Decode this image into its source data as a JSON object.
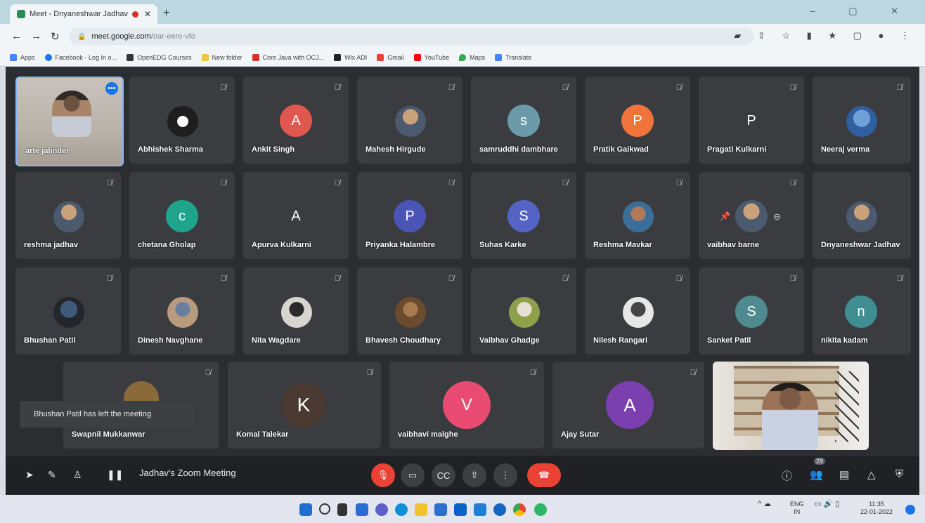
{
  "browser": {
    "tab_title": "Meet - Dnyaneshwar Jadhav",
    "new_tab": "+",
    "window_controls": "– ▢ ✕",
    "url_host": "meet.google.com",
    "url_path": "/oar-eere-vfo",
    "bookmarks": [
      {
        "label": "Apps",
        "color": "#4285f4"
      },
      {
        "label": "Facebook - Log In o...",
        "color": "#1877f2"
      },
      {
        "label": "OpenEDG Courses",
        "color": "#333333"
      },
      {
        "label": "New folder",
        "color": "#f4c542"
      },
      {
        "label": "Core Java with OCJ...",
        "color": "#d93025"
      },
      {
        "label": "Wix ADI",
        "color": "#222222"
      },
      {
        "label": "Gmail",
        "color": "#ea4335"
      },
      {
        "label": "YouTube",
        "color": "#ff0000"
      },
      {
        "label": "Maps",
        "color": "#34a853"
      },
      {
        "label": "Translate",
        "color": "#4285f4"
      }
    ]
  },
  "participants_row1": [
    {
      "name": "arte jalinder",
      "type": "self"
    },
    {
      "name": "Abhishek Sharma",
      "initial": "",
      "color": "#3a3c40",
      "photo": true
    },
    {
      "name": "Ankit Singh",
      "initial": "A",
      "color": "#e0574f"
    },
    {
      "name": "Mahesh Hirgude",
      "initial": "",
      "color": "#3a3c40",
      "photo": true
    },
    {
      "name": "samruddhi dambhare",
      "initial": "s",
      "color": "#6b9aa8"
    },
    {
      "name": "Pratik Gaikwad",
      "initial": "P",
      "color": "#f0733c"
    },
    {
      "name": "Pragati Kulkarni",
      "initial": "P",
      "color": "#3a3c40"
    },
    {
      "name": "Neeraj verma",
      "initial": "",
      "color": "#3a3c40",
      "photo": true
    }
  ],
  "participants_row2": [
    {
      "name": "reshma jadhav",
      "initial": "",
      "photo": true
    },
    {
      "name": "chetana Gholap",
      "initial": "c",
      "color": "#1fa58c"
    },
    {
      "name": "Apurva Kulkarni",
      "initial": "A",
      "color": "#3a3c40"
    },
    {
      "name": "Priyanka Halambre",
      "initial": "P",
      "color": "#4b55b5"
    },
    {
      "name": "Suhas Karke",
      "initial": "S",
      "color": "#5563c4"
    },
    {
      "name": "Reshma Mavkar",
      "initial": "",
      "photo": true
    },
    {
      "name": "vaibhav barne",
      "initial": "",
      "photo": true
    },
    {
      "name": "Dnyaneshwar Jadhav",
      "initial": "",
      "photo": true
    }
  ],
  "participants_row3": [
    {
      "name": "Bhushan Patil",
      "initial": "",
      "photo": true
    },
    {
      "name": "Dinesh Navghane",
      "initial": "",
      "photo": true
    },
    {
      "name": "Nita Wagdare",
      "initial": "",
      "photo": true
    },
    {
      "name": "Bhavesh Choudhary",
      "initial": "",
      "photo": true
    },
    {
      "name": "Vaibhav Ghadge",
      "initial": "",
      "photo": true
    },
    {
      "name": "Nilesh Rangari",
      "initial": "",
      "photo": true
    },
    {
      "name": "Sanket Patil",
      "initial": "S",
      "color": "#4f8a8f"
    },
    {
      "name": "nikita kadam",
      "initial": "n",
      "color": "#3e8e92"
    }
  ],
  "participants_row4": [
    {
      "name": "Swapnil Mukkanwar",
      "initial": "",
      "photo": true
    },
    {
      "name": "Komal Talekar",
      "initial": "K",
      "color": "#4a3a32"
    },
    {
      "name": "vaibhavi malghe",
      "initial": "V",
      "color": "#e94b72"
    },
    {
      "name": "Ajay Sutar",
      "initial": "A",
      "color": "#7b3fb0"
    }
  ],
  "toast": "Bhushan Patil has left the meeting",
  "meeting_title": "Jadhav's Zoom Meeting",
  "participant_count": "29",
  "taskbar": {
    "lang_top": "ENG",
    "lang_bottom": "IN",
    "time": "11:35",
    "date": "22-01-2022"
  }
}
